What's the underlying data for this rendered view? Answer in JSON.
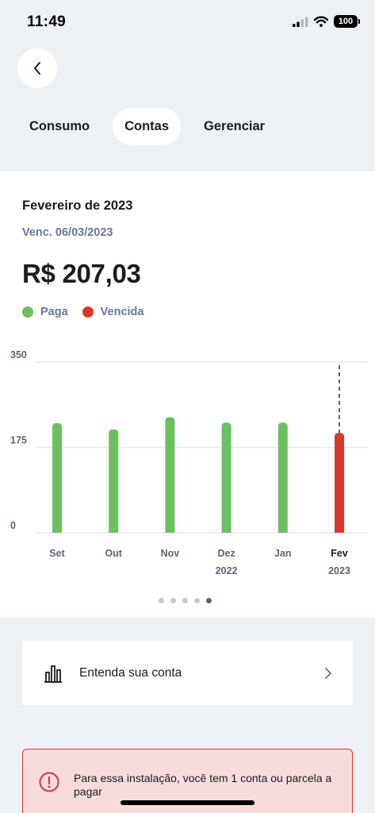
{
  "status_bar": {
    "time": "11:49",
    "battery": "100"
  },
  "tabs": [
    {
      "label": "Consumo",
      "active": false
    },
    {
      "label": "Contas",
      "active": true
    },
    {
      "label": "Gerenciar",
      "active": false
    }
  ],
  "bill": {
    "month": "Fevereiro de 2023",
    "due_date": "Venc. 06/03/2023",
    "amount": "R$ 207,03"
  },
  "legend": [
    {
      "label": "Paga",
      "color": "#6cc062"
    },
    {
      "label": "Vencida",
      "color": "#d9372a"
    }
  ],
  "chart_data": {
    "type": "bar",
    "categories": [
      "Set",
      "Out",
      "Nov",
      "Dez",
      "Jan",
      "Fev"
    ],
    "category_sublabels": [
      "",
      "",
      "",
      "2022",
      "",
      "2023"
    ],
    "values": [
      225,
      212,
      237,
      226,
      226,
      205
    ],
    "status": [
      "Paga",
      "Paga",
      "Paga",
      "Paga",
      "Paga",
      "Vencida"
    ],
    "colors": [
      "#6cc062",
      "#6cc062",
      "#6cc062",
      "#6cc062",
      "#6cc062",
      "#d9372a"
    ],
    "yticks": [
      "0",
      "175",
      "350"
    ],
    "ylim": [
      0,
      350
    ],
    "selected_index": 5,
    "grid": true
  },
  "pager": {
    "count": 5,
    "active": 4
  },
  "explain": {
    "label": "Entenda sua conta"
  },
  "alert": {
    "text": "Para essa instalação, você tem 1 conta ou parcela a pagar"
  }
}
